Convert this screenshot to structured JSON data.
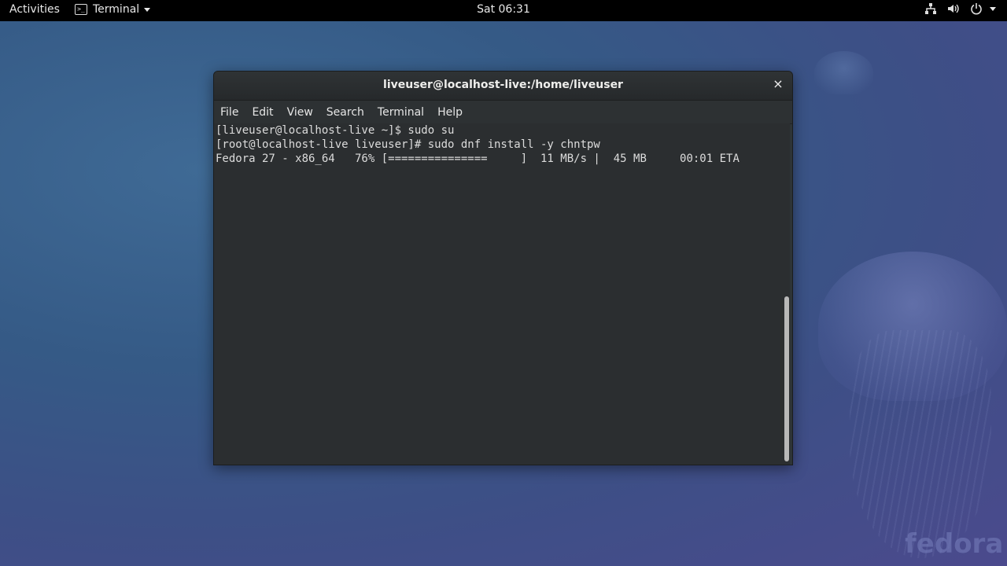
{
  "topbar": {
    "activities": "Activities",
    "app_name": "Terminal",
    "app_icon_glyph": ">_",
    "clock": "Sat 06:31",
    "tray_icons": [
      "network-icon",
      "volume-icon",
      "power-icon"
    ]
  },
  "window": {
    "title": "liveuser@localhost-live:/home/liveuser",
    "close_glyph": "×",
    "menu": [
      "File",
      "Edit",
      "View",
      "Search",
      "Terminal",
      "Help"
    ]
  },
  "terminal": {
    "lines": [
      "[liveuser@localhost-live ~]$ sudo su",
      "[root@localhost-live liveuser]# sudo dnf install -y chntpw",
      "Fedora 27 - x86_64   76% [===============     ]  11 MB/s |  45 MB     00:01 ETA"
    ]
  },
  "desktop": {
    "logo_text": "fedora"
  }
}
